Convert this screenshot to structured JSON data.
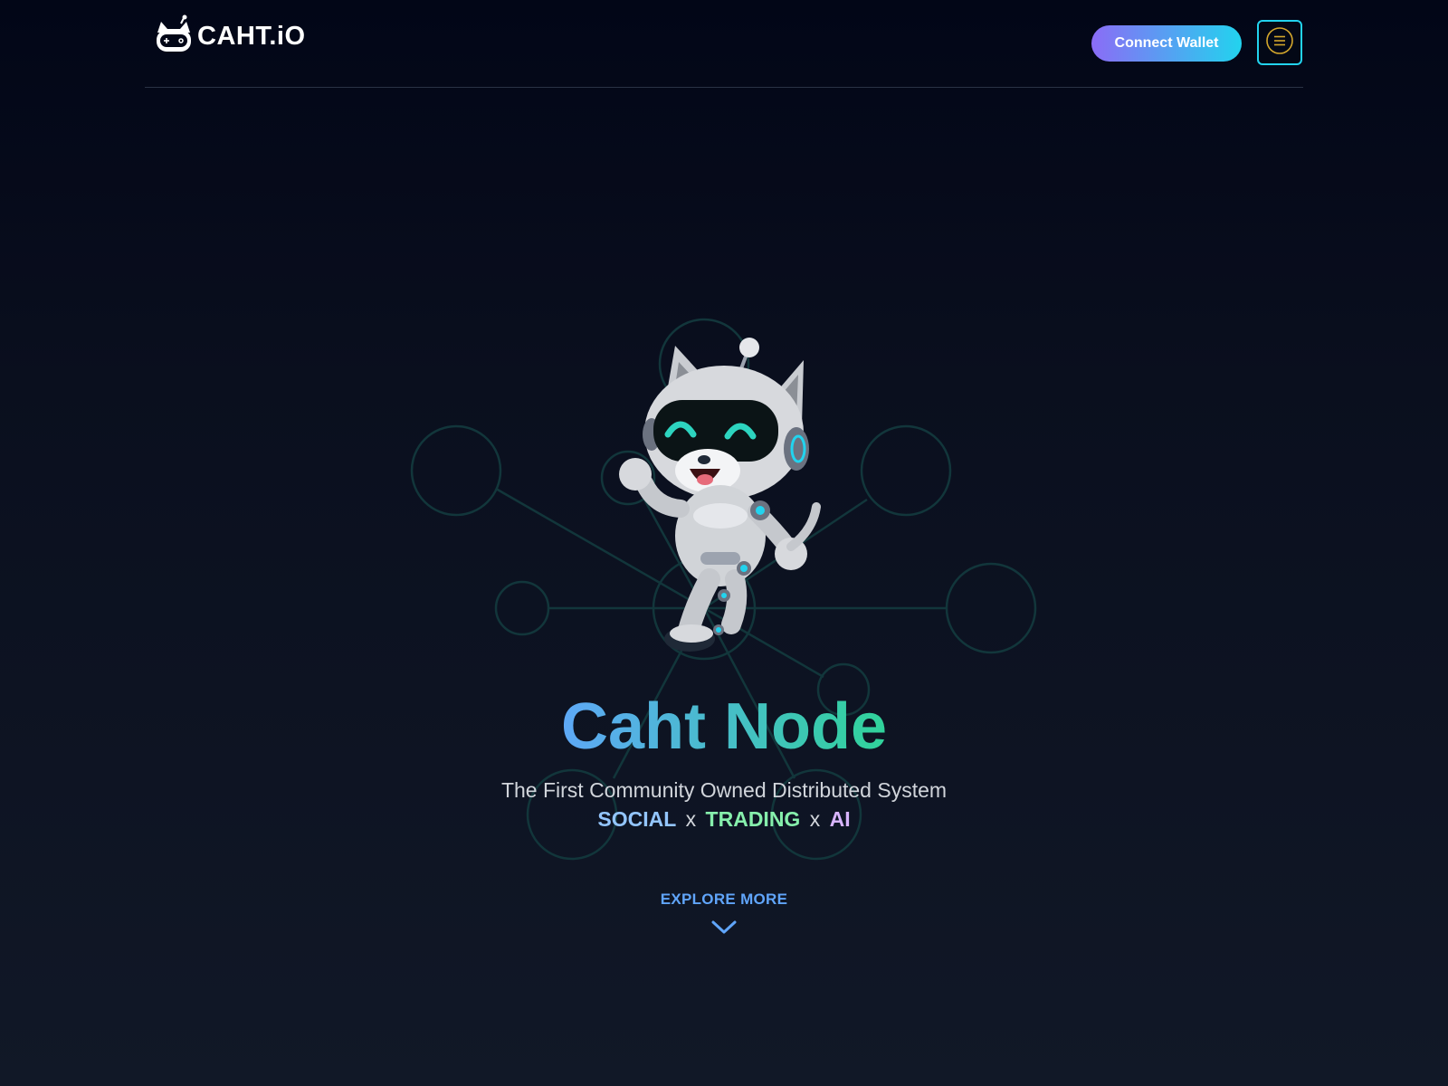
{
  "header": {
    "logo_text": "CAHT.iO",
    "logo_icon": "robot-cat-icon",
    "connect_wallet_label": "Connect Wallet",
    "menu_icon": "menu-icon"
  },
  "hero": {
    "mascot": "robot-cat-illustration",
    "title": "Caht Node",
    "subtitle": "The First Community Owned Distributed System",
    "tagline": {
      "social": "SOCIAL",
      "sep1": "x",
      "trading": "TRADING",
      "sep2": "x",
      "ai": "AI"
    },
    "explore_label": "EXPLORE MORE",
    "explore_icon": "chevron-down-icon"
  },
  "colors": {
    "accent_blue": "#60a5fa",
    "accent_green": "#34d399",
    "accent_cyan": "#22d3ee",
    "accent_purple": "#8b6cf6",
    "network_line": "#12363b"
  }
}
